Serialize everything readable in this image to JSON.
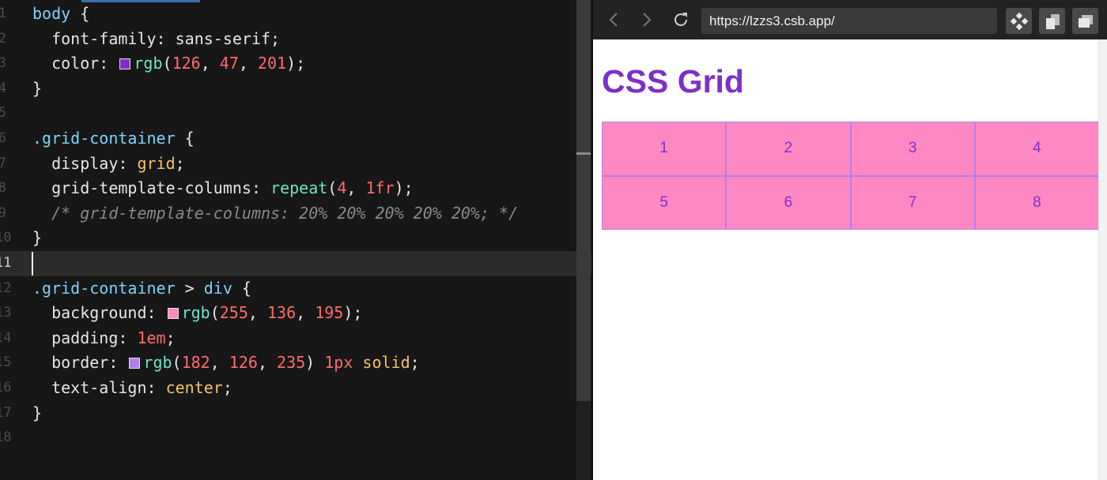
{
  "editor": {
    "lines": [
      {
        "n": "1",
        "segs": [
          {
            "c": "sel",
            "t": "body"
          },
          {
            "t": " {"
          }
        ]
      },
      {
        "n": "2",
        "segs": [
          {
            "t": "  "
          },
          {
            "c": "prop",
            "t": "font-family: "
          },
          {
            "c": "prop",
            "t": "sans-serif;"
          }
        ]
      },
      {
        "n": "3",
        "segs": [
          {
            "t": "  "
          },
          {
            "c": "prop",
            "t": "color: "
          },
          {
            "sw": "#7e2fc9"
          },
          {
            "c": "fn",
            "t": "rgb"
          },
          {
            "t": "("
          },
          {
            "c": "num",
            "t": "126"
          },
          {
            "t": ", "
          },
          {
            "c": "num",
            "t": "47"
          },
          {
            "t": ", "
          },
          {
            "c": "num",
            "t": "201"
          },
          {
            "t": ");"
          }
        ]
      },
      {
        "n": "4",
        "segs": [
          {
            "t": "}"
          }
        ]
      },
      {
        "n": "5",
        "segs": []
      },
      {
        "n": "6",
        "segs": [
          {
            "c": "sel",
            "t": ".grid-container"
          },
          {
            "t": " {"
          }
        ]
      },
      {
        "n": "7",
        "segs": [
          {
            "t": "  "
          },
          {
            "c": "prop",
            "t": "display: "
          },
          {
            "c": "kw",
            "t": "grid"
          },
          {
            "t": ";"
          }
        ]
      },
      {
        "n": "8",
        "segs": [
          {
            "t": "  "
          },
          {
            "c": "prop",
            "t": "grid-template-columns: "
          },
          {
            "c": "fn",
            "t": "repeat"
          },
          {
            "t": "("
          },
          {
            "c": "num",
            "t": "4"
          },
          {
            "t": ", "
          },
          {
            "c": "num",
            "t": "1fr"
          },
          {
            "t": ");"
          }
        ]
      },
      {
        "n": "9",
        "segs": [
          {
            "t": "  "
          },
          {
            "c": "cm",
            "t": "/* grid-template-columns: 20% 20% 20% 20% 20%; */"
          }
        ]
      },
      {
        "n": "10",
        "segs": [
          {
            "t": "}"
          }
        ]
      },
      {
        "n": "11",
        "current": true,
        "segs": []
      },
      {
        "n": "12",
        "segs": [
          {
            "c": "sel",
            "t": ".grid-container"
          },
          {
            "t": " > "
          },
          {
            "c": "sel",
            "t": "div"
          },
          {
            "t": " {"
          }
        ]
      },
      {
        "n": "13",
        "segs": [
          {
            "t": "  "
          },
          {
            "c": "prop",
            "t": "background: "
          },
          {
            "sw": "#ff88c3"
          },
          {
            "c": "fn",
            "t": "rgb"
          },
          {
            "t": "("
          },
          {
            "c": "num",
            "t": "255"
          },
          {
            "t": ", "
          },
          {
            "c": "num",
            "t": "136"
          },
          {
            "t": ", "
          },
          {
            "c": "num",
            "t": "195"
          },
          {
            "t": ");"
          }
        ]
      },
      {
        "n": "14",
        "segs": [
          {
            "t": "  "
          },
          {
            "c": "prop",
            "t": "padding: "
          },
          {
            "c": "num",
            "t": "1em"
          },
          {
            "t": ";"
          }
        ]
      },
      {
        "n": "15",
        "segs": [
          {
            "t": "  "
          },
          {
            "c": "prop",
            "t": "border: "
          },
          {
            "sw": "#b67eeb"
          },
          {
            "c": "fn",
            "t": "rgb"
          },
          {
            "t": "("
          },
          {
            "c": "num",
            "t": "182"
          },
          {
            "t": ", "
          },
          {
            "c": "num",
            "t": "126"
          },
          {
            "t": ", "
          },
          {
            "c": "num",
            "t": "235"
          },
          {
            "t": ") "
          },
          {
            "c": "num",
            "t": "1px"
          },
          {
            "t": " "
          },
          {
            "c": "kw",
            "t": "solid"
          },
          {
            "t": ";"
          }
        ]
      },
      {
        "n": "16",
        "segs": [
          {
            "t": "  "
          },
          {
            "c": "prop",
            "t": "text-align: "
          },
          {
            "c": "kw",
            "t": "center"
          },
          {
            "t": ";"
          }
        ]
      },
      {
        "n": "17",
        "segs": [
          {
            "t": "}"
          }
        ]
      },
      {
        "n": "18",
        "segs": []
      }
    ]
  },
  "browser": {
    "url": "https://lzzs3.csb.app/",
    "back_icon": "chevron-left-icon",
    "forward_icon": "chevron-right-icon",
    "reload_icon": "reload-icon",
    "toolbar_icons": [
      "codesandbox-icon",
      "copy-icon",
      "window-icon"
    ],
    "page": {
      "heading": "CSS Grid",
      "text_color": "#7e2fc9",
      "cell_background": "#ff88c3",
      "cell_border": "#b67eeb",
      "cells": [
        "1",
        "2",
        "3",
        "4",
        "5",
        "6",
        "7",
        "8"
      ]
    }
  }
}
